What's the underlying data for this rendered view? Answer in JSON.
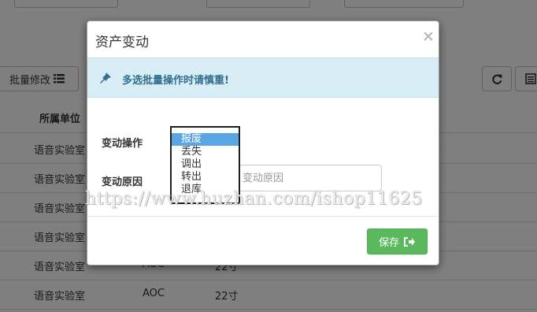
{
  "background": {
    "toolbar": {
      "batch_edit_label": "批量修改"
    },
    "table": {
      "headers": [
        "所属单位"
      ],
      "rows": [
        [
          "语音实验室",
          "",
          ""
        ],
        [
          "语音实验室",
          "",
          ""
        ],
        [
          "语音实验室",
          "",
          ""
        ],
        [
          "语音实验室",
          "",
          ""
        ],
        [
          "语音实验室",
          "AOC",
          "22寸"
        ],
        [
          "语音实验室",
          "AOC",
          "22寸"
        ]
      ]
    }
  },
  "modal": {
    "title": "资产变动",
    "close_symbol": "×",
    "alert": {
      "text": "多选批量操作时请慎重!",
      "icon": "pin-icon",
      "color": "#31708f"
    },
    "form": {
      "operation_label": "变动操作",
      "reason_label": "变动原因",
      "reason_placeholder": "变动原因",
      "reason_value": "",
      "options": [
        "报废",
        "丢失",
        "调出",
        "转出",
        "退库"
      ],
      "selected_option": "报废"
    },
    "save_label": "保存",
    "save_color": "#5cb85c"
  },
  "watermark": "https://www.huzhan.com/ishop11625"
}
